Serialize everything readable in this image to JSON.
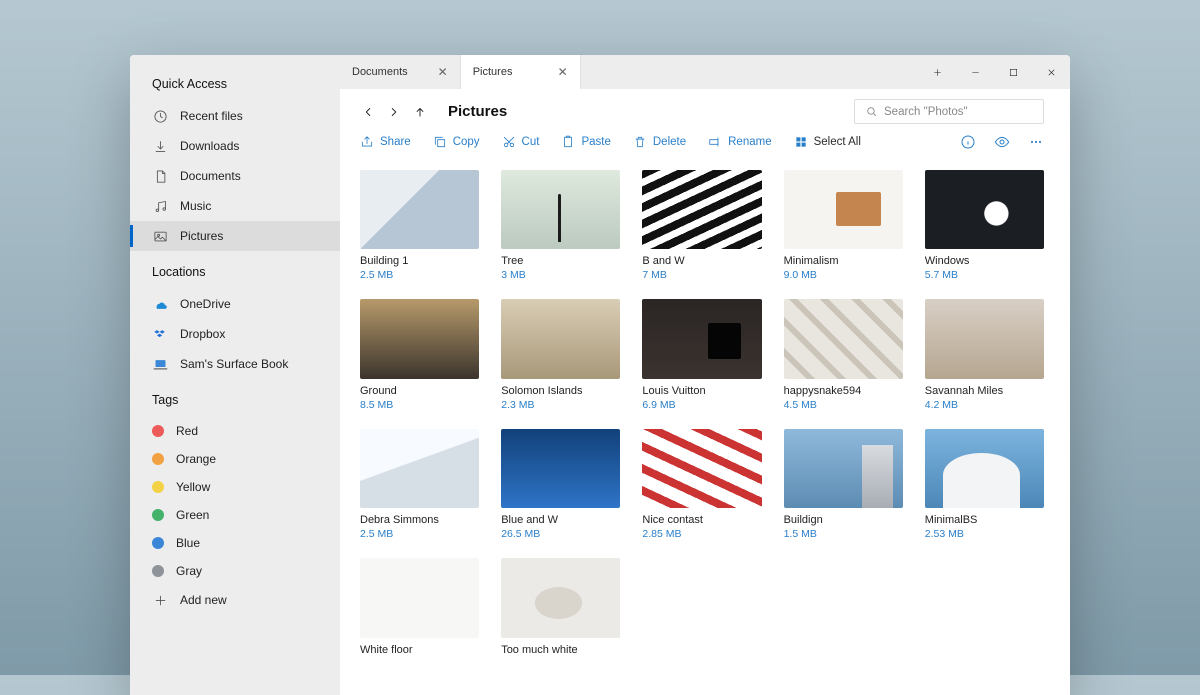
{
  "sidebar": {
    "quickAccess": {
      "heading": "Quick Access",
      "items": [
        {
          "label": "Recent files",
          "icon": "clock-icon"
        },
        {
          "label": "Downloads",
          "icon": "download-icon"
        },
        {
          "label": "Documents",
          "icon": "document-icon"
        },
        {
          "label": "Music",
          "icon": "music-icon"
        },
        {
          "label": "Pictures",
          "icon": "picture-icon",
          "active": true
        }
      ]
    },
    "locations": {
      "heading": "Locations",
      "items": [
        {
          "label": "OneDrive",
          "icon": "onedrive-icon"
        },
        {
          "label": "Dropbox",
          "icon": "dropbox-icon"
        },
        {
          "label": "Sam's Surface Book",
          "icon": "laptop-icon"
        }
      ]
    },
    "tags": {
      "heading": "Tags",
      "items": [
        {
          "label": "Red",
          "color": "#ed5a5a"
        },
        {
          "label": "Orange",
          "color": "#f2a142"
        },
        {
          "label": "Yellow",
          "color": "#f4d245"
        },
        {
          "label": "Green",
          "color": "#45b26b"
        },
        {
          "label": "Blue",
          "color": "#3b85d6"
        },
        {
          "label": "Gray",
          "color": "#8d9398"
        }
      ],
      "addNew": "Add new"
    }
  },
  "tabs": [
    {
      "label": "Documents",
      "active": false
    },
    {
      "label": "Pictures",
      "active": true
    }
  ],
  "header": {
    "title": "Pictures",
    "search_placeholder": "Search \"Photos\""
  },
  "toolbar": {
    "share": "Share",
    "copy": "Copy",
    "cut": "Cut",
    "paste": "Paste",
    "delete": "Delete",
    "rename": "Rename",
    "selectAll": "Select All"
  },
  "files": [
    {
      "name": "Building 1",
      "size": "2.5 MB"
    },
    {
      "name": "Tree",
      "size": "3 MB"
    },
    {
      "name": "B and W",
      "size": "7 MB"
    },
    {
      "name": "Minimalism",
      "size": "9.0 MB"
    },
    {
      "name": "Windows",
      "size": "5.7 MB"
    },
    {
      "name": "Ground",
      "size": "8.5 MB"
    },
    {
      "name": "Solomon Islands",
      "size": "2.3 MB"
    },
    {
      "name": "Louis Vuitton",
      "size": "6.9 MB"
    },
    {
      "name": "happysnake594",
      "size": "4.5 MB"
    },
    {
      "name": "Savannah Miles",
      "size": "4.2 MB"
    },
    {
      "name": "Debra Simmons",
      "size": "2.5 MB"
    },
    {
      "name": "Blue and W",
      "size": "26.5 MB"
    },
    {
      "name": "Nice contast",
      "size": "2.85 MB"
    },
    {
      "name": "Buildign",
      "size": "1.5 MB"
    },
    {
      "name": "MinimalBS",
      "size": "2.53 MB"
    },
    {
      "name": "White floor",
      "size": ""
    },
    {
      "name": "Too much white",
      "size": ""
    }
  ]
}
